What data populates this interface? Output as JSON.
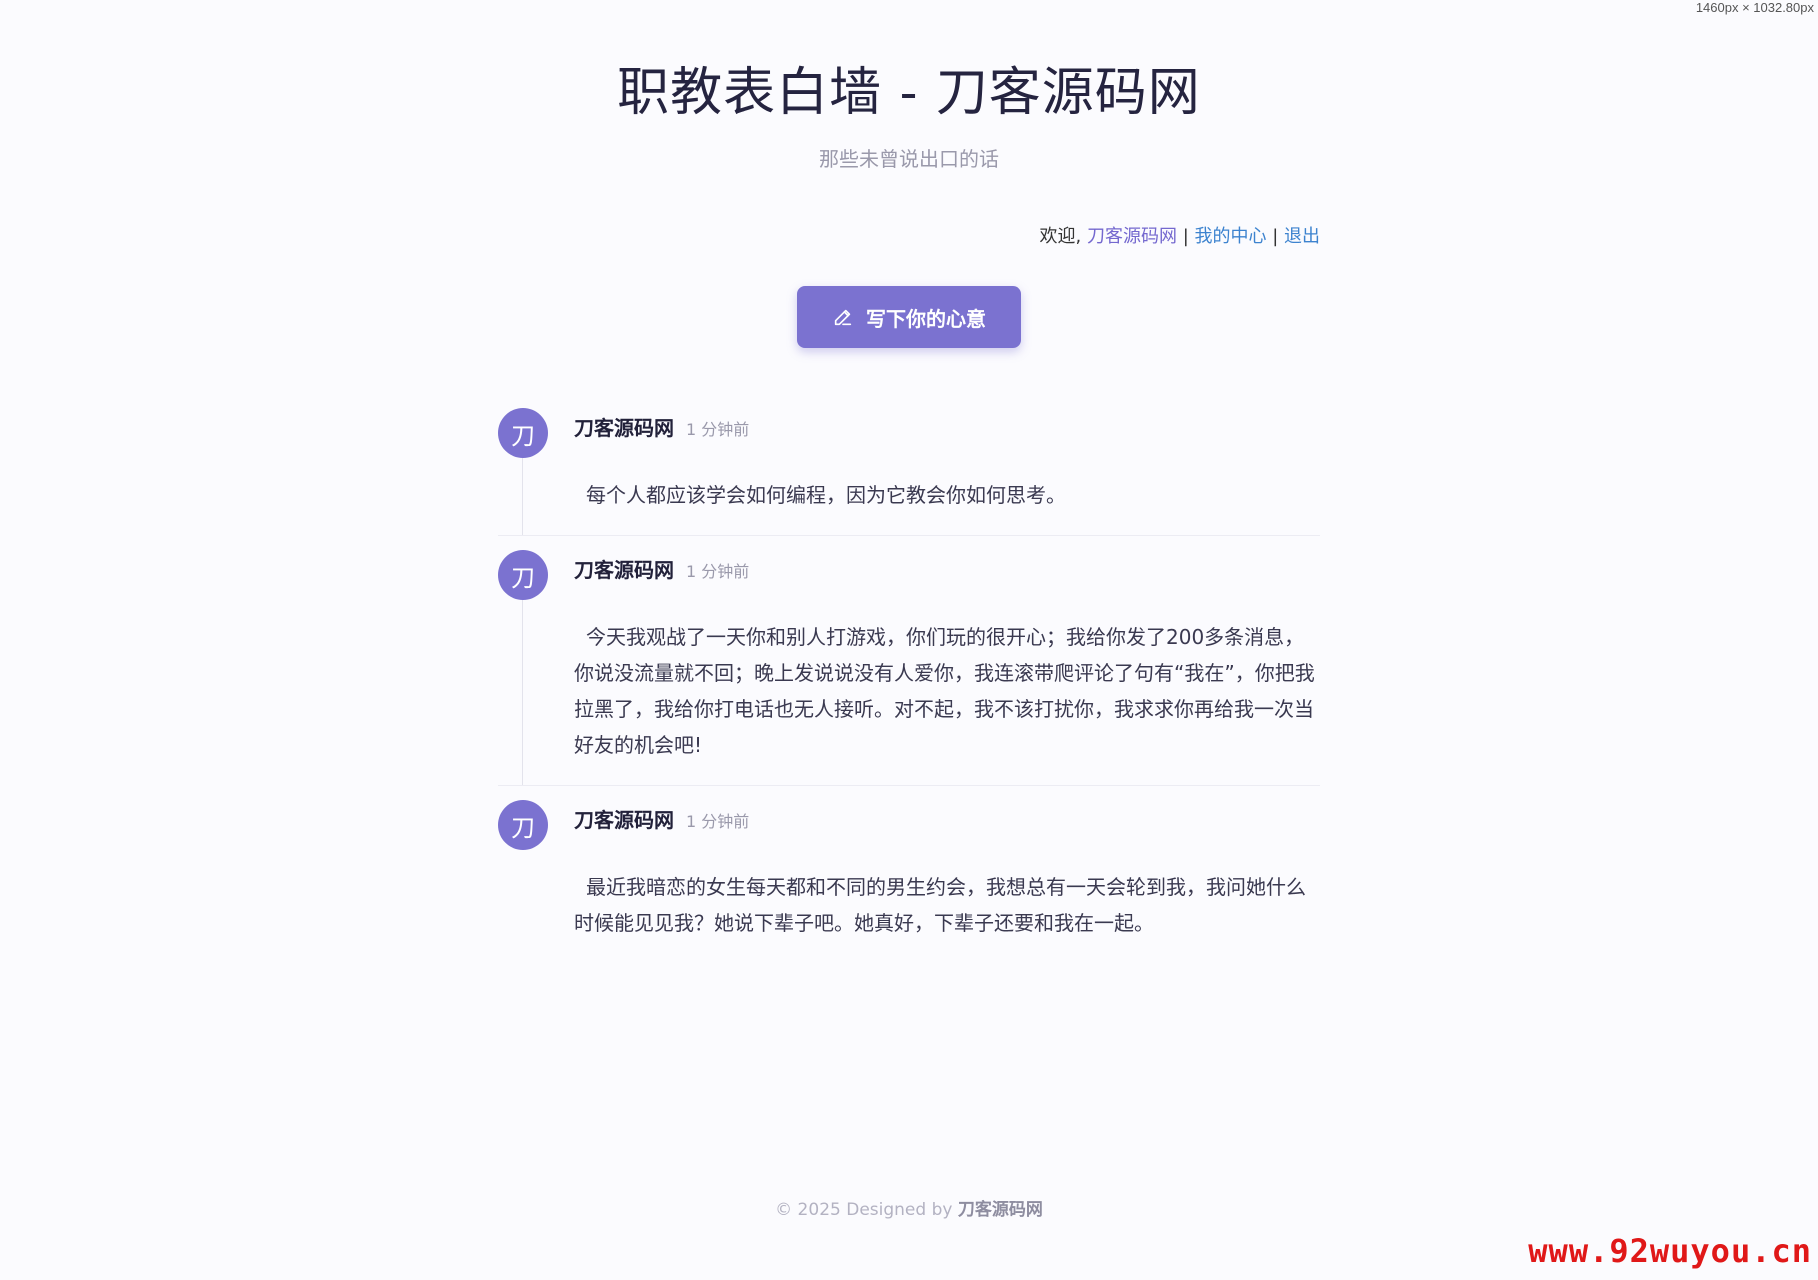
{
  "viewport_readout": "1460px × 1032.80px",
  "header": {
    "title": "职教表白墙 - 刀客源码网",
    "subtitle": "那些未曾说出口的话"
  },
  "userbar": {
    "welcome": "欢迎, ",
    "username": "刀客源码网",
    "sep1": " | ",
    "my_center": "我的中心",
    "sep2": " | ",
    "logout": "退出"
  },
  "write_button": {
    "label": "写下你的心意",
    "icon": "pencil-icon"
  },
  "posts": [
    {
      "avatar": "刀",
      "author": "刀客源码网",
      "time": "1 分钟前",
      "content": "每个人都应该学会如何编程，因为它教会你如何思考。"
    },
    {
      "avatar": "刀",
      "author": "刀客源码网",
      "time": "1 分钟前",
      "content": "今天我观战了一天你和别人打游戏，你们玩的很开心；我给你发了200多条消息，你说没流量就不回；晚上发说说没有人爱你，我连滚带爬评论了句有“我在”，你把我拉黑了，我给你打电话也无人接听。对不起，我不该打扰你，我求求你再给我一次当好友的机会吧!"
    },
    {
      "avatar": "刀",
      "author": "刀客源码网",
      "time": "1 分钟前",
      "content": "最近我暗恋的女生每天都和不同的男生约会，我想总有一天会轮到我，我问她什么时候能见见我？她说下辈子吧。她真好，下辈子还要和我在一起。"
    }
  ],
  "footer": {
    "text": "© 2025 Designed by ",
    "brand": "刀客源码网"
  },
  "watermark": "www.92wuyou.cn",
  "colors": {
    "accent": "#7b72d0",
    "link": "#3d83cf",
    "background": "#fbfbfe"
  }
}
